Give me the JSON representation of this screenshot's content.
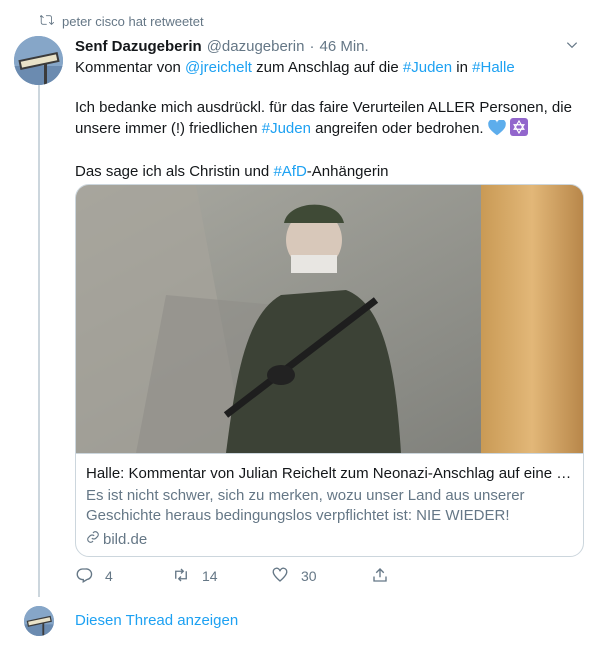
{
  "retweet_context": {
    "text": "peter cisco hat retweetet",
    "icon": "retweet-icon"
  },
  "tweet": {
    "author_name": "Senf Dazugeberin",
    "author_handle": "@dazugeberin",
    "separator": "·",
    "time": "46 Min.",
    "body": {
      "line1_prefix": "Kommentar von ",
      "line1_mention": "@jreichelt",
      "line1_mid": " zum Anschlag auf die ",
      "line1_tag1": "#Juden",
      "line1_mid2": " in ",
      "line1_tag2": "#Halle",
      "para2_start": "Ich bedanke mich ausdrückl. für das faire Verurteilen ALLER Personen, die unsere immer (!) friedlichen ",
      "para2_tag": "#Juden",
      "para2_end": " angreifen oder bedrohen. ",
      "para3_start": "Das sage ich als Christin und ",
      "para3_tag": "#AfD",
      "para3_end": "-Anhängerin"
    },
    "card": {
      "title": "Halle: Kommentar von Julian Reichelt zum Neonazi-Anschlag auf eine S...",
      "description": "Es ist nicht schwer, sich zu merken, wozu unser Land aus unserer Geschichte heraus bedingungslos verpflichtet ist: NIE WIEDER!",
      "domain": "bild.de",
      "domain_icon": "link-icon"
    },
    "actions": {
      "reply_count": "4",
      "retweet_count": "14",
      "like_count": "30"
    }
  },
  "show_thread_label": "Diesen Thread anzeigen",
  "colors": {
    "link": "#1da1f2",
    "secondary_text": "#657786",
    "border": "#ccd6dd",
    "primary_text": "#14171a"
  }
}
